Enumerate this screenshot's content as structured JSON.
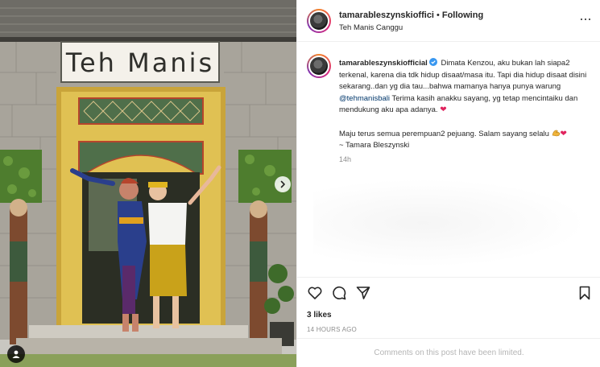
{
  "photo": {
    "sign_text": "Teh Manis",
    "next_icon": "chevron-right-icon",
    "tag_icon": "user-tag-icon"
  },
  "post_header": {
    "username": "tamarableszynskioffici",
    "separator": "•",
    "follow_status": "Following",
    "location": "Teh Manis Canggu",
    "more_icon": "more-options-icon"
  },
  "caption": {
    "username": "tamarableszynskiofficial",
    "verified_icon": "verified-badge-icon",
    "text_part1": "Dimata Kenzou, aku bukan lah siapa2 terkenal, karena dia tdk hidup disaat/masa itu. Tapi dia hidup disaat disini sekarang..dan yg dia tau...bahwa mamanya hanya punya warung ",
    "mention": "@tehmanisbali",
    "text_part2": " Terima kasih anakku sayang, yg tetap mencintaiku dan mendukung aku apa adanya.",
    "heart": "❤",
    "text_part3": "Maju terus semua perempuan2 pejuang. Salam sayang selalu",
    "text_part4": "~ Tamara Bleszynski",
    "time": "14h"
  },
  "actions": {
    "like_icon": "heart-icon",
    "comment_icon": "comment-icon",
    "share_icon": "share-icon",
    "save_icon": "bookmark-icon"
  },
  "likes": "3 likes",
  "posted_ago": "14 HOURS AGO",
  "comments_notice": "Comments on this post have been limited.",
  "colors": {
    "text": "#262626",
    "muted": "#8e8e8e",
    "link": "#00376b",
    "border": "#efefef",
    "heart": "#e0245e"
  }
}
